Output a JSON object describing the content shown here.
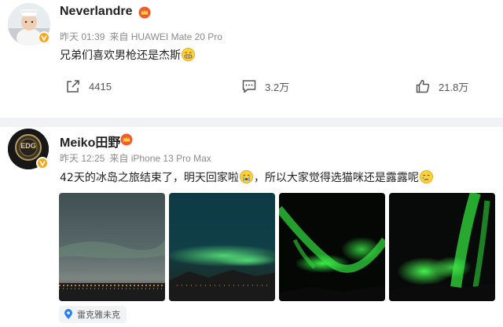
{
  "posts": [
    {
      "username": "Neverlandre",
      "time": "昨天 01:39",
      "source": "来自 HUAWEI Mate 20 Pro",
      "text": "兄弟们喜欢男枪还是杰斯",
      "emoji": "grin-emoji",
      "actions": {
        "share_icon": "share-icon",
        "share_count": "4415",
        "comment_icon": "comment-icon",
        "comment_count": "3.2万",
        "like_icon": "thumbs-up-icon",
        "like_count": "21.8万"
      }
    },
    {
      "username": "Meiko田野",
      "avatar_text": "EDG",
      "time": "昨天 12:25",
      "source": "来自 iPhone 13 Pro Max",
      "text_part1": "42天的冰岛之旅结束了，明天回家啦",
      "text_part2": "，所以大家觉得选猫咪还是露露呢",
      "images": [
        "aurora-photo-1",
        "aurora-photo-2",
        "aurora-photo-3",
        "aurora-photo-4"
      ],
      "location": {
        "icon": "location-pin-icon",
        "label": "雷克雅未克"
      }
    }
  ],
  "colors": {
    "badge": "#f6a516",
    "crown": "#f25a2c",
    "meta": "#8a8a8a",
    "divider": "#f1f2f5",
    "aurora": "#2fd13a"
  }
}
